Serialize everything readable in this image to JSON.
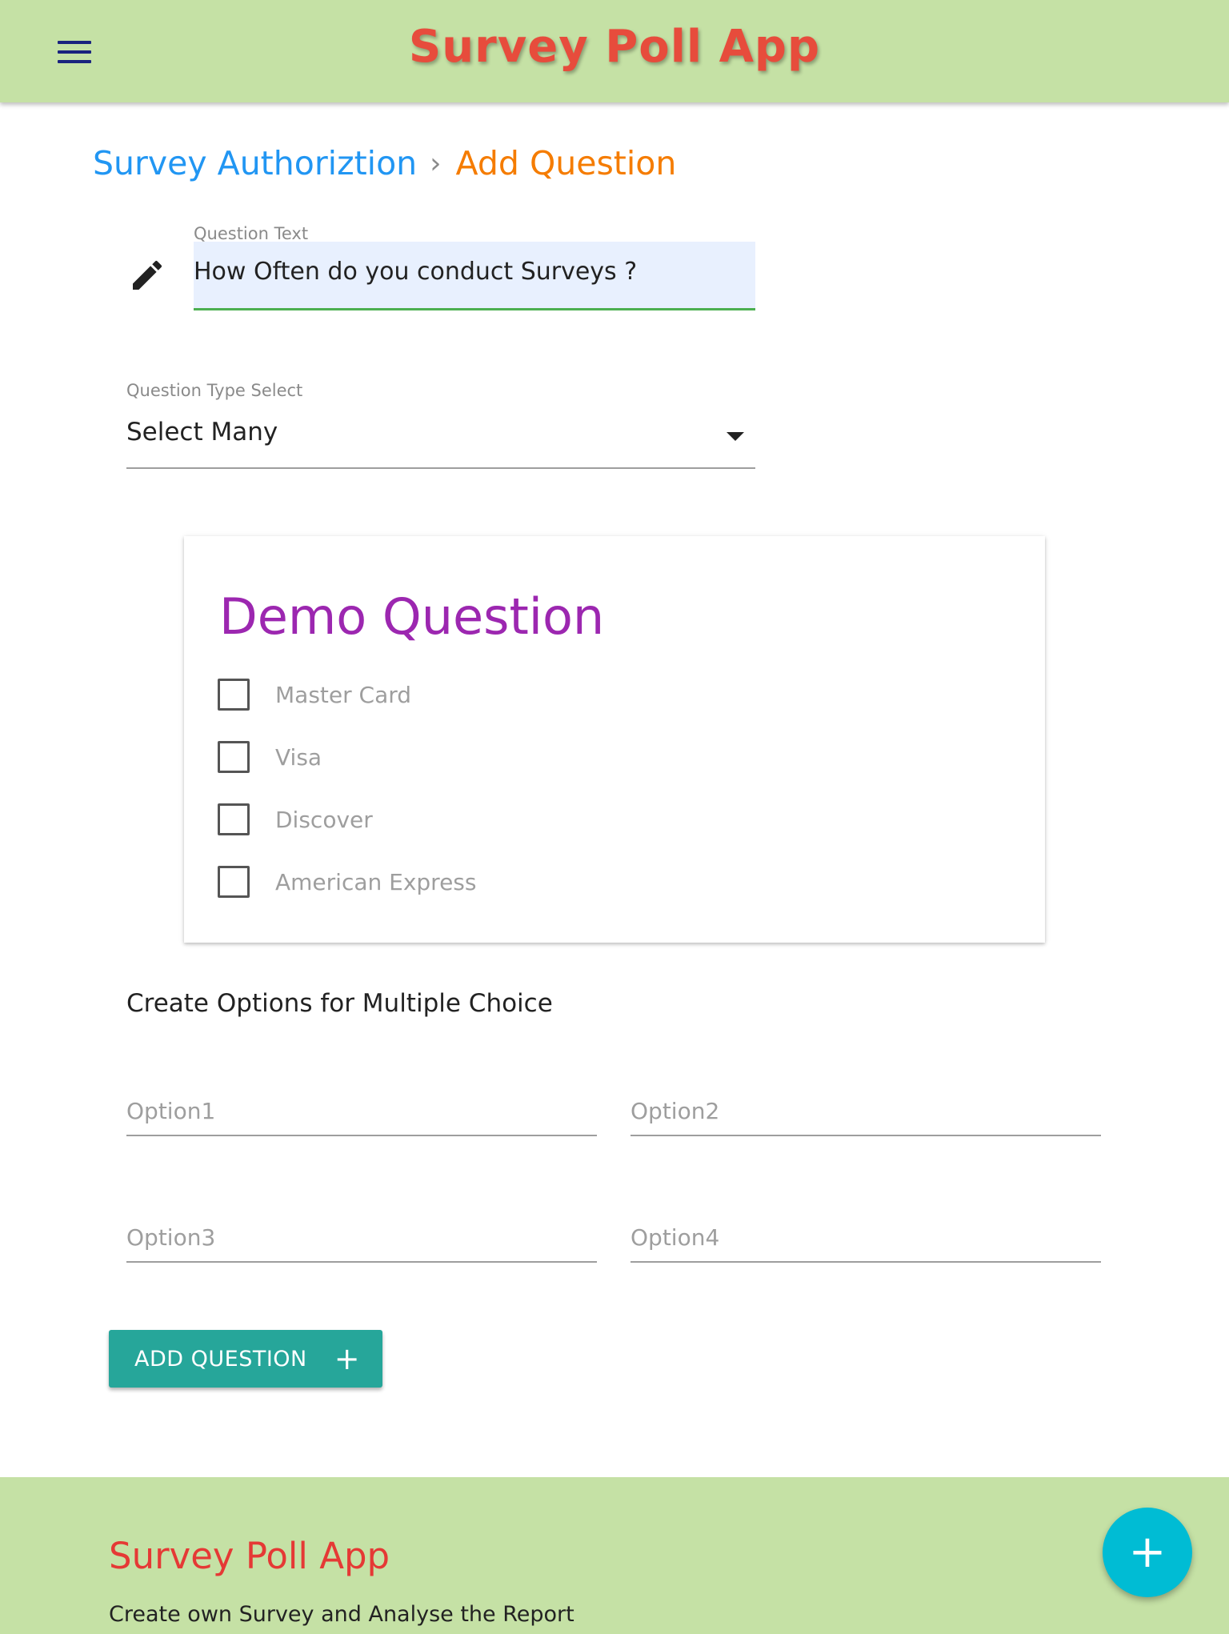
{
  "header": {
    "title": "Survey Poll App",
    "menu_icon": "hamburger-menu-icon"
  },
  "breadcrumb": {
    "parent": "Survey Authoriztion",
    "separator": "›",
    "current": "Add Question"
  },
  "question_text": {
    "label": "Question Text",
    "value": "How Often do you conduct Surveys ?",
    "icon": "pencil-icon"
  },
  "question_type": {
    "label": "Question Type Select",
    "selected": "Select Many"
  },
  "demo_card": {
    "title": "Demo Question",
    "options": [
      {
        "label": "Master Card",
        "checked": false
      },
      {
        "label": "Visa",
        "checked": false
      },
      {
        "label": "Discover",
        "checked": false
      },
      {
        "label": "American Express",
        "checked": false
      }
    ]
  },
  "options_section": {
    "heading": "Create Options for Multiple Choice",
    "fields": [
      {
        "placeholder": "Option1",
        "value": ""
      },
      {
        "placeholder": "Option2",
        "value": ""
      },
      {
        "placeholder": "Option3",
        "value": ""
      },
      {
        "placeholder": "Option4",
        "value": ""
      }
    ]
  },
  "add_button": {
    "label": "ADD QUESTION",
    "icon": "+"
  },
  "footer": {
    "title": "Survey Poll App",
    "subtitle": "Create own Survey and Analyse the Report"
  },
  "fab": {
    "icon": "+"
  },
  "colors": {
    "header_bg": "#c5e1a5",
    "title_red": "#e74c3c",
    "link_blue": "#2196f3",
    "current_orange": "#f57c00",
    "card_title_purple": "#9c27b0",
    "field_underline_green": "#4caf50",
    "button_teal": "#26a69a",
    "fab_cyan": "#00bcd4"
  }
}
